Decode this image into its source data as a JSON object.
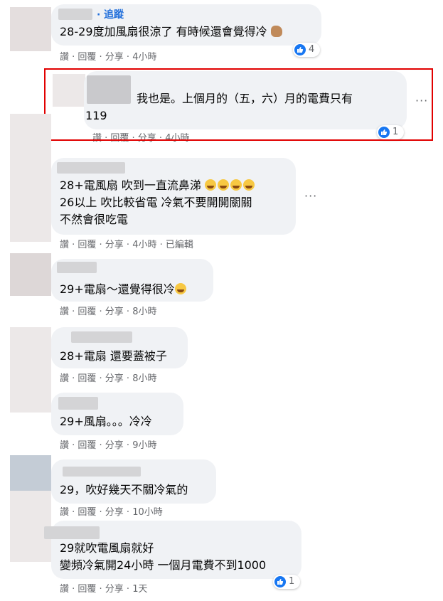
{
  "accent": "#216fdb",
  "highlight_color": "#e10000",
  "comments": [
    {
      "follow": "追蹤",
      "text": "28-29度加風扇很涼了 有時候還會覺得冷",
      "actions": "讚 · 回覆 · 分享 · 4小時",
      "reactions": "4"
    },
    {
      "text_line1": "我也是。上個月的（五，六）月的電費只有",
      "text_line2": "119",
      "actions": "讚 · 回覆 · 分享 · 4小時",
      "reactions": "1",
      "more": "···"
    },
    {
      "text_line1": "28+電風扇 吹到一直流鼻涕",
      "text_line2": "26以上 吹比較省電 冷氣不要開開關關",
      "text_line3": "不然會很吃電",
      "actions": "讚 · 回覆 · 分享 · 4小時 · 已編輯",
      "more": "···"
    },
    {
      "text": "29+電扇～還覺得很冷",
      "actions": "讚 · 回覆 · 分享 · 8小時"
    },
    {
      "text": "28+電扇 還要蓋被子",
      "actions": "讚 · 回覆 · 分享 · 8小時"
    },
    {
      "text": "29+風扇。。。冷冷",
      "actions": "讚 · 回覆 · 分享 · 9小時"
    },
    {
      "text": "29，吹好幾天不關冷氣的",
      "actions": "讚 · 回覆 · 分享 · 10小時"
    },
    {
      "text_line1": "29就吹電風扇就好",
      "text_line2": "變頻冷氣開24小時 一個月電費不到1000",
      "actions": "讚 · 回覆 · 分享 · 1天",
      "reactions": "1"
    }
  ]
}
